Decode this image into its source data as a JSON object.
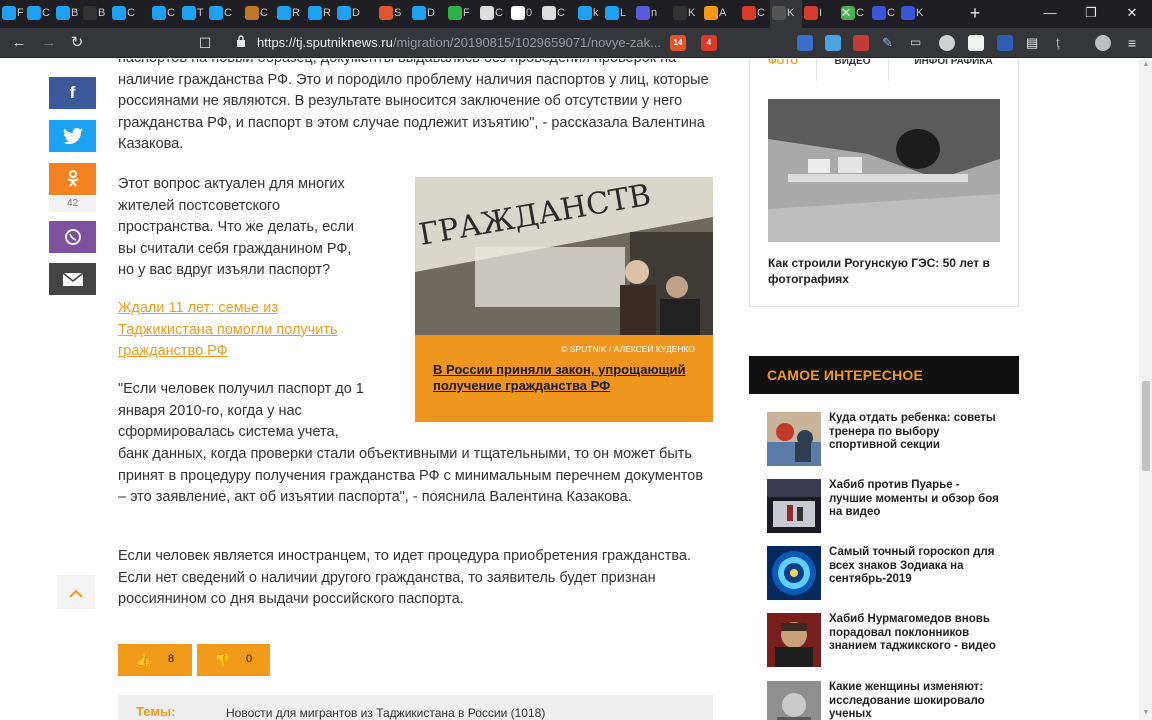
{
  "browser": {
    "tabs": [
      {
        "icon": "twitter-icon",
        "label": "F",
        "color": "#1da1f2"
      },
      {
        "icon": "twitter-icon",
        "label": "C",
        "color": "#1da1f2"
      },
      {
        "icon": "twitter-icon",
        "label": "B",
        "color": "#1da1f2"
      },
      {
        "icon": "dots-icon",
        "label": "B",
        "color": "#333333"
      },
      {
        "icon": "twitter-icon",
        "label": "C",
        "color": "#1da1f2"
      },
      {
        "icon": "twitter-icon",
        "label": "C",
        "color": "#1da1f2"
      },
      {
        "icon": "twitter-icon",
        "label": "T",
        "color": "#1da1f2"
      },
      {
        "icon": "twitter-icon",
        "label": "C",
        "color": "#1da1f2"
      },
      {
        "icon": "pattern-icon",
        "label": "C",
        "color": "#c0762a"
      },
      {
        "icon": "twitter-icon",
        "label": "R",
        "color": "#1da1f2"
      },
      {
        "icon": "twitter-icon",
        "label": "R",
        "color": "#1da1f2"
      },
      {
        "icon": "twitter-icon",
        "label": "D",
        "color": "#1da1f2"
      },
      {
        "icon": "circle-icon",
        "label": "S",
        "color": "#e0552c"
      },
      {
        "icon": "twitter-icon",
        "label": "D",
        "color": "#1da1f2"
      },
      {
        "icon": "globe-icon",
        "label": "F",
        "color": "#2eb34a"
      },
      {
        "icon": "globe-icon",
        "label": "C",
        "color": "#dddddd"
      },
      {
        "icon": "t-icon",
        "label": "0",
        "color": "#ffffff"
      },
      {
        "icon": "globe-icon",
        "label": "C",
        "color": "#dddddd"
      },
      {
        "icon": "twitter-icon",
        "label": "k",
        "color": "#1da1f2"
      },
      {
        "icon": "twitter-icon",
        "label": "L",
        "color": "#1da1f2"
      },
      {
        "icon": "flag-icon",
        "label": "n",
        "color": "#5a5adf"
      },
      {
        "icon": "kaz-icon",
        "label": "K",
        "color": "#333333"
      },
      {
        "icon": "arrow-icon",
        "label": "A",
        "color": "#f29b1b"
      },
      {
        "icon": "ru-icon",
        "label": "C",
        "color": "#d83b2b"
      },
      {
        "icon": "k-icon",
        "label": "K",
        "color": "#555555"
      },
      {
        "icon": "ru-icon",
        "label": "I",
        "color": "#d83b2b"
      },
      {
        "icon": "puzzle-icon",
        "label": "C",
        "color": "#4caf50"
      },
      {
        "icon": "globe-icon",
        "label": "C",
        "color": "#3b55d8"
      },
      {
        "icon": "globe-icon",
        "label": "K",
        "color": "#3b55d8"
      }
    ],
    "url_host": "https://tj.sputniknews.ru",
    "url_path": "/migration/20190815/1029659071/novye-zak...",
    "brave_badge": "14",
    "alert_badge": "4",
    "accent": "#f29b1b"
  },
  "share": {
    "facebook_label": "f",
    "twitter_label": "t",
    "ok_label": "ок",
    "ok_count": "42",
    "viber_label": "v",
    "email_label": "✉",
    "up_label": "︿"
  },
  "article": {
    "para1": "паспортов на новый образец, документы выдавались без проведения проверок на наличие гражданства РФ. Это и породило проблему наличия паспортов у лиц, которые россиянами не являются. В результате выносится заключение об отсутствии у него гражданства РФ, и паспорт в этом случае подлежит изъятию\", - рассказала Валентина Казакова.",
    "para2": "Этот вопрос актуален для многих жителей постсоветского пространства. Что же делать, если вы считали себя гражданином РФ, но у вас вдруг изъяли паспорт?",
    "related_link": "Ждали 11 лет: семье из Таджикистана помогли получить гражданство РФ",
    "para3_a": "\"Если человек получил паспорт до 1 января 2010-го, когда у нас сформировалась система учета,",
    "para3_b": "банк данных, когда проверки стали объективными и тщательными, то он может быть принят в процедуру получения гражданства РФ с минимальным перечнем документов – это заявление, акт об изъятии паспорта\", - пояснила Валентина Казакова.",
    "para4": "Если человек является иностранцем, то идет процедура приобретения гражданства. Если нет сведений о наличии другого гражданства, то заявитель будет признан россиянином со дня выдачи российского паспорта.",
    "figure_sign_text": "ГРАЖДАНСТВ",
    "figure_credit": "© SPUTNIK / АЛЕКСЕЙ КУДЕНКО",
    "figure_caption": "В России приняли закон, упрощающий получение гражданства РФ",
    "likes": "8",
    "dislikes": "0",
    "topics_label": "Темы:",
    "topics_value": "Новости для мигрантов из Таджикистана в России (1018)"
  },
  "sidebar": {
    "tabs": [
      "ФОТО",
      "ВИДЕО",
      "ИНФОГРАФИКА"
    ],
    "media_caption": "Как строили Рогунскую ГЭС: 50 лет в фотографиях",
    "interesting_title": "САМОЕ ИНТЕРЕСНОЕ",
    "news": [
      {
        "title": "Куда отдать ребенка: советы тренера по выбору спортивной секции",
        "thumb": "boxing-photo"
      },
      {
        "title": "Хабиб против Пуарье - лучшие моменты и обзор боя на видео",
        "thumb": "arena-photo"
      },
      {
        "title": "Самый точный гороскоп для всех знаков Зодиака на сентябрь-2019",
        "thumb": "zodiac-photo"
      },
      {
        "title": "Хабиб Нурмагомедов вновь порадовал поклонников знанием таджикского - видео",
        "thumb": "fighter-photo"
      },
      {
        "title": "Какие женщины изменяют: исследование шокировало ученых",
        "thumb": "woman-photo"
      }
    ]
  }
}
